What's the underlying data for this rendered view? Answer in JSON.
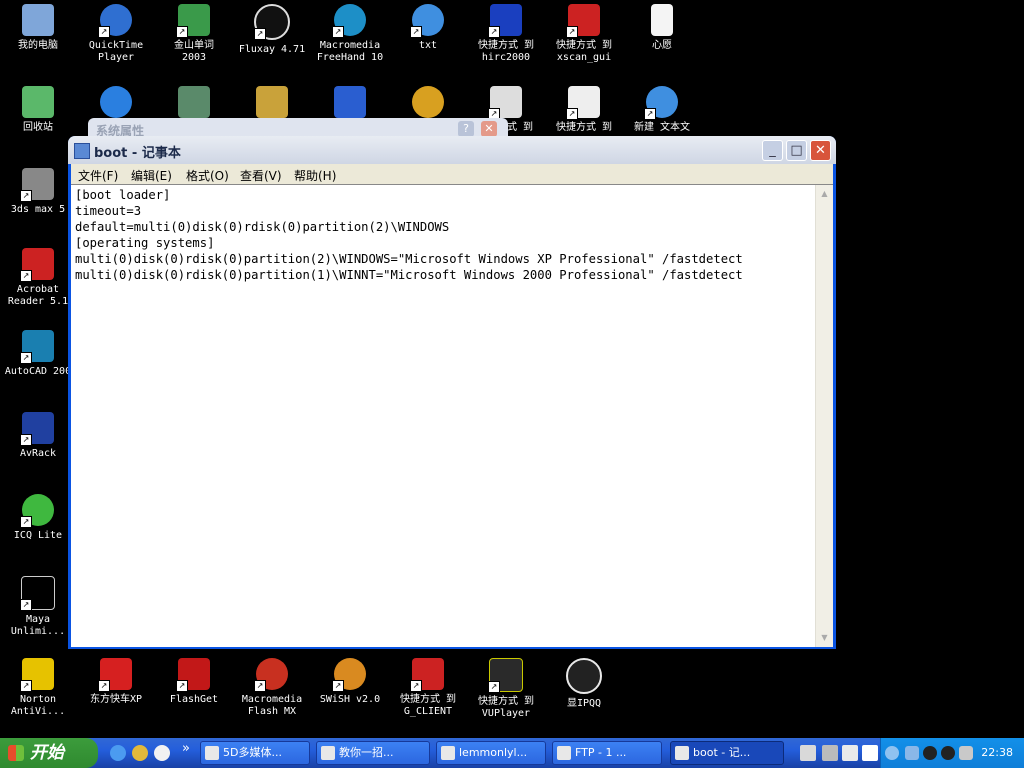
{
  "desktop_icons": [
    {
      "label": "我的电脑"
    },
    {
      "label": "QuickTime\nPlayer"
    },
    {
      "label": "金山单词\n2003"
    },
    {
      "label": "Fluxay 4.71"
    },
    {
      "label": "Macromedia\nFreeHand 10"
    },
    {
      "label": "txt"
    },
    {
      "label": "快捷方式 到\nhirc2000"
    },
    {
      "label": "快捷方式 到\nxscan_gui"
    },
    {
      "label": "心愿"
    },
    {
      "label": "回收站"
    },
    {
      "label": "式 到"
    },
    {
      "label": "快捷方式 到"
    },
    {
      "label": "新建 文本文"
    },
    {
      "label": "3ds max 5"
    },
    {
      "label": "Acrobat\nReader 5.1"
    },
    {
      "label": "AutoCAD 200"
    },
    {
      "label": "AvRack"
    },
    {
      "label": "ICQ Lite"
    },
    {
      "label": "Maya\nUnlimi..."
    },
    {
      "label": "Norton\nAntiVi..."
    },
    {
      "label": "东方快车XP"
    },
    {
      "label": "FlashGet"
    },
    {
      "label": "Macromedia\nFlash MX"
    },
    {
      "label": "SWiSH v2.0"
    },
    {
      "label": "快捷方式 到\nG_CLIENT"
    },
    {
      "label": "快捷方式 到\nVUPlayer"
    },
    {
      "label": "显IPQQ"
    }
  ],
  "background_dialog": {
    "title": "系统属性"
  },
  "notepad": {
    "title": "boot - 记事本",
    "menu": [
      "文件(F)",
      "编辑(E)",
      "格式(O)",
      "查看(V)",
      "帮助(H)"
    ],
    "lines": [
      "[boot loader]",
      "timeout=3",
      "default=multi(0)disk(0)rdisk(0)partition(2)\\WINDOWS",
      "[operating systems]",
      "multi(0)disk(0)rdisk(0)partition(2)\\WINDOWS=\"Microsoft Windows XP Professional\" /fastdetect",
      "multi(0)disk(0)rdisk(0)partition(1)\\WINNT=\"Microsoft Windows 2000 Professional\" /fastdetect"
    ]
  },
  "taskbar": {
    "start_label": "开始",
    "quicklaunch_more": "»",
    "tasks": [
      {
        "label": "5D多媒体..."
      },
      {
        "label": "教你一招..."
      },
      {
        "label": "lemmonlyl..."
      },
      {
        "label": "FTP - 1 ..."
      },
      {
        "label": "boot - 记..."
      }
    ],
    "clock": "22:38"
  }
}
